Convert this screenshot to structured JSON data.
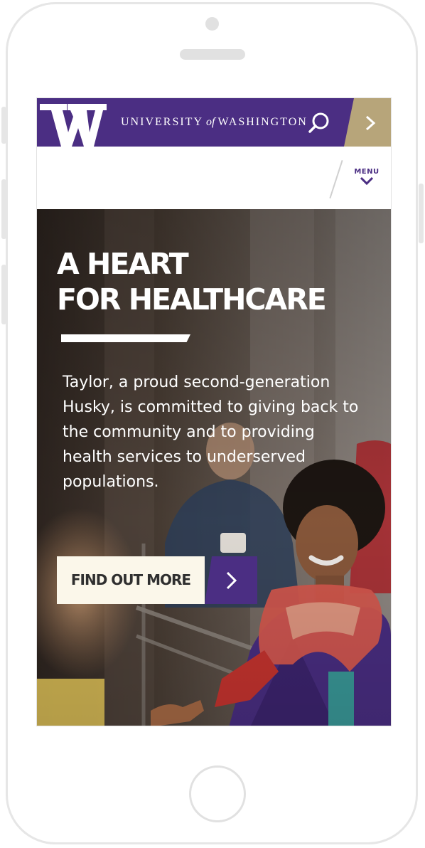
{
  "header": {
    "logo_letter": "W",
    "wordmark_left": "UNIVERSITY",
    "wordmark_of": "of",
    "wordmark_right": "WASHINGTON",
    "colors": {
      "purple": "#4b2e83",
      "gold": "#b7a57a"
    },
    "search_icon": "search-icon",
    "quick_links_icon": "chevron-right-icon"
  },
  "nav": {
    "menu_label": "MENU",
    "menu_icon": "chevron-down-icon"
  },
  "hero": {
    "title_line1": "A HEART",
    "title_line2": "FOR HEALTHCARE",
    "body": "Taylor, a proud second-generation Husky, is committed to giving back to the community and to providing health services to underserved populations.",
    "cta_label": "FIND OUT MORE",
    "cta_icon": "chevron-right-icon"
  }
}
